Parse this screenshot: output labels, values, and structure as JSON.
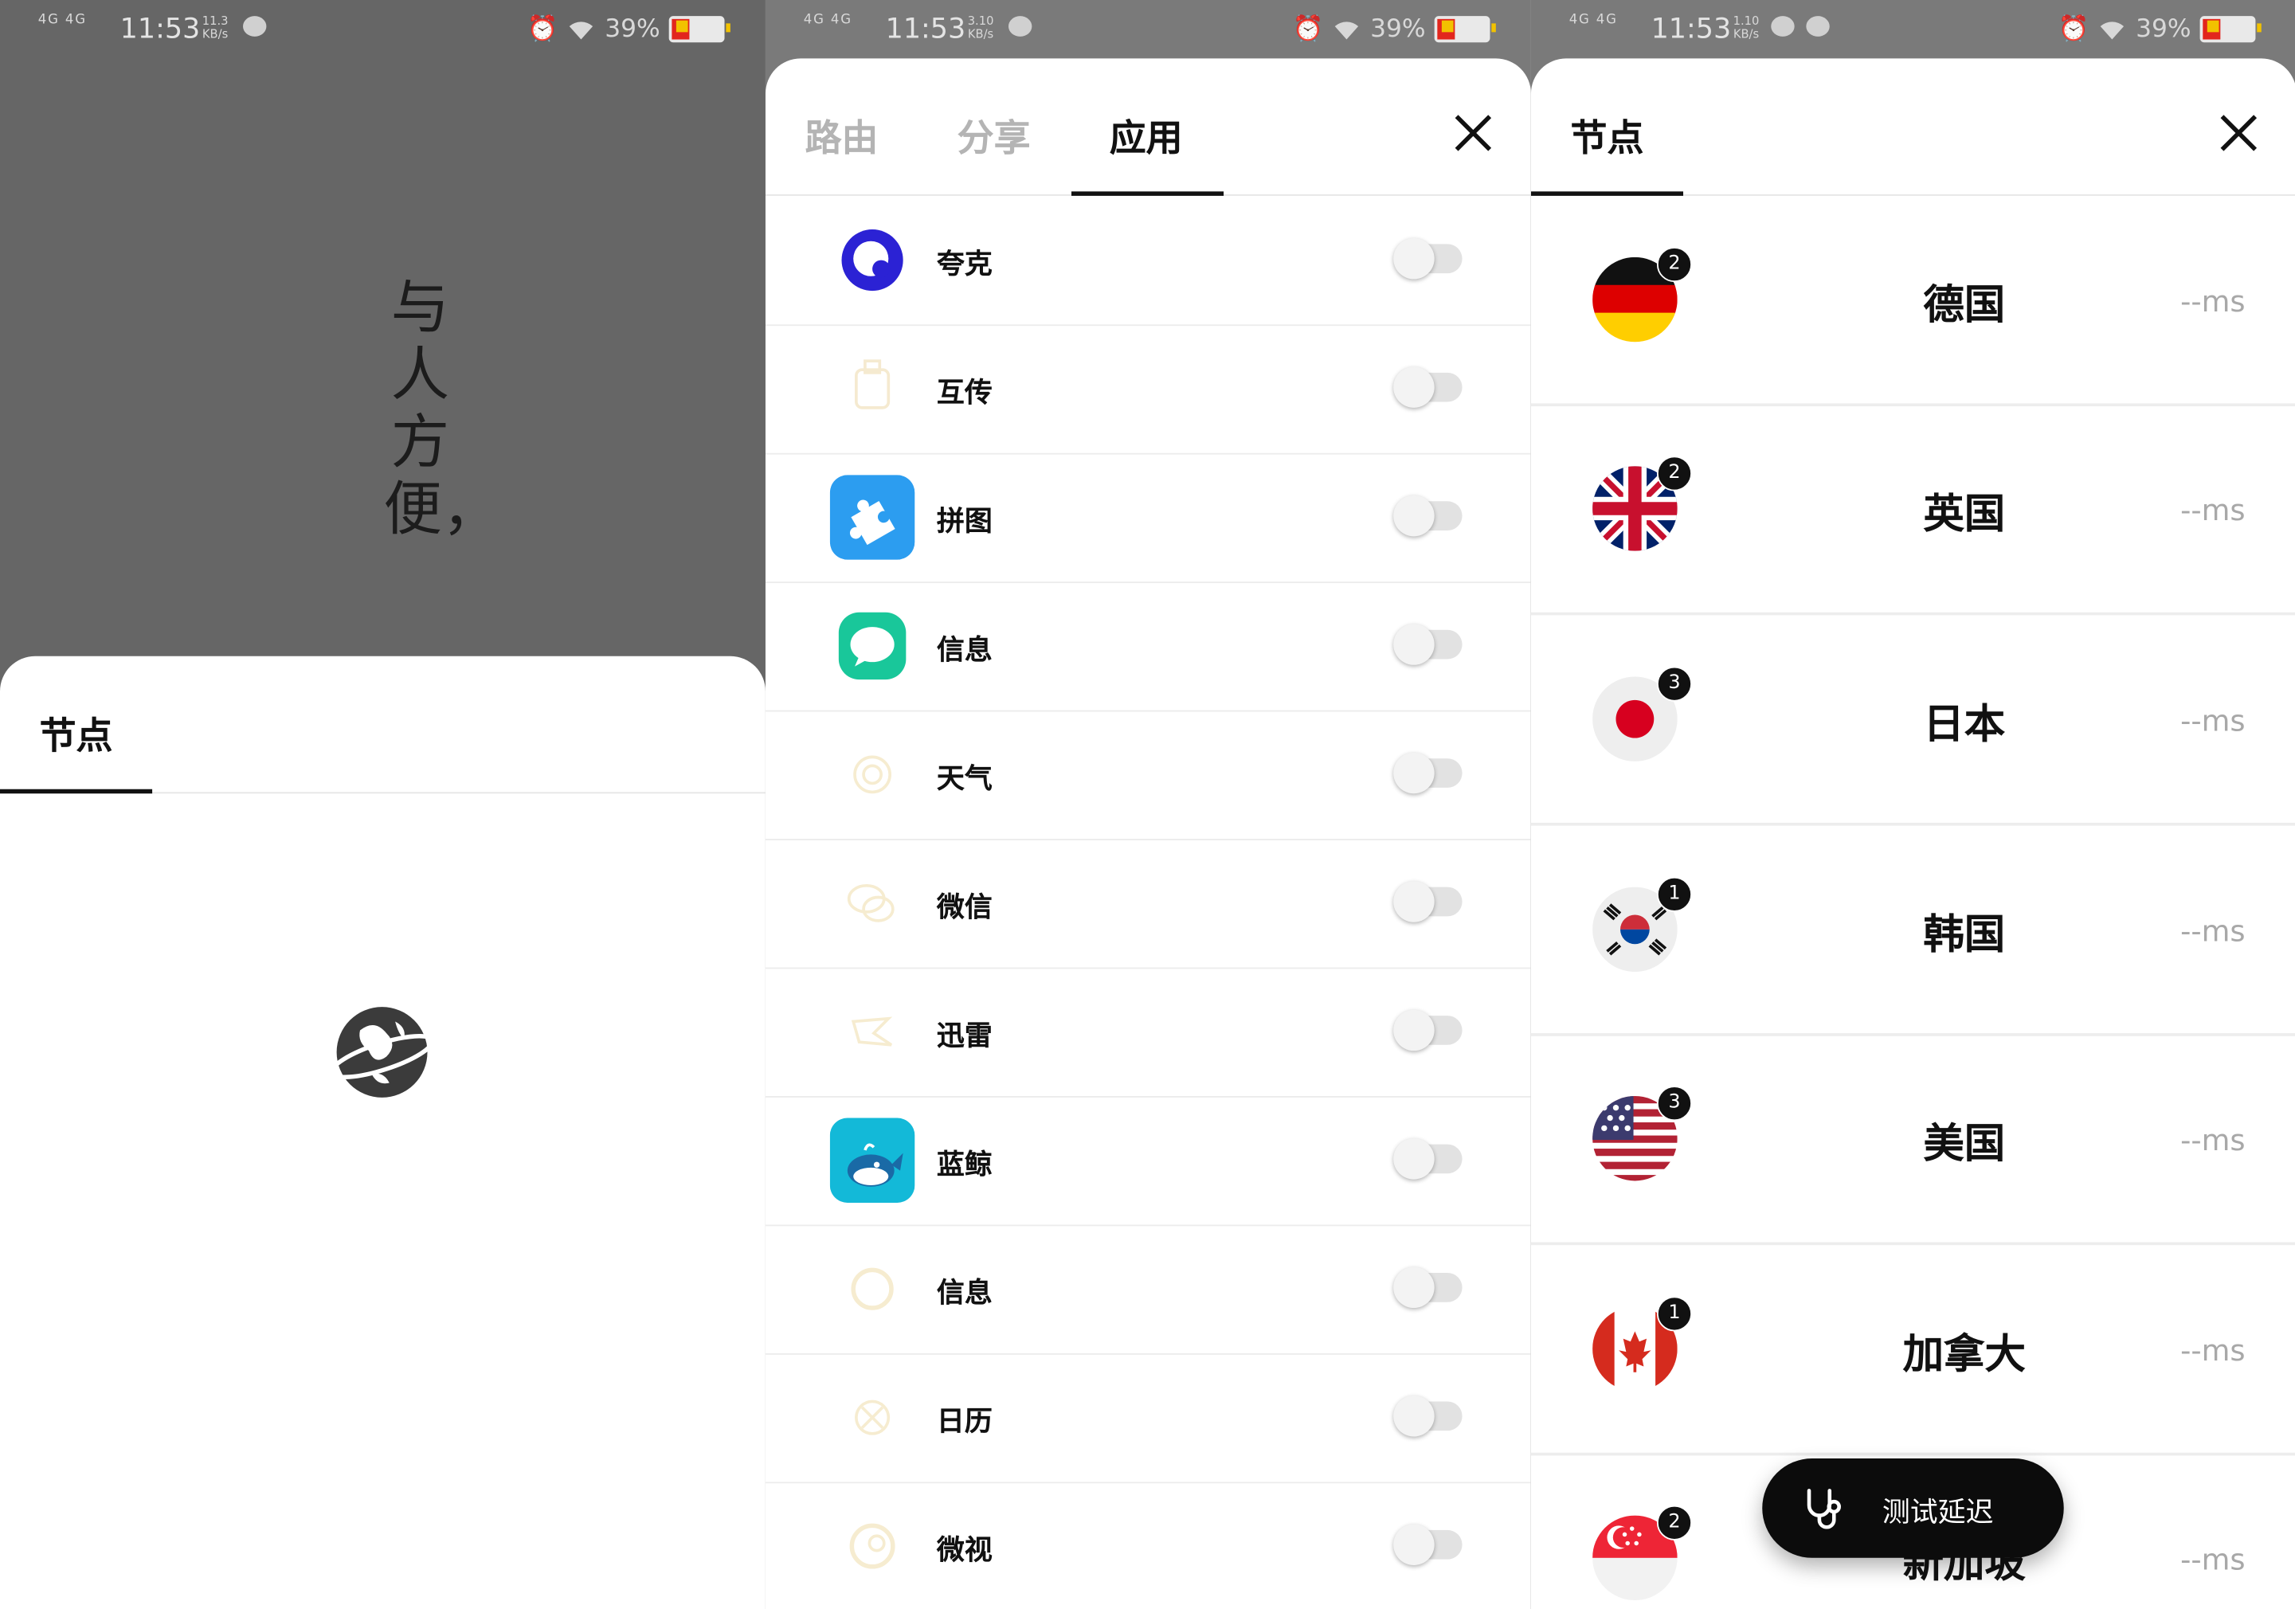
{
  "status_bars": [
    {
      "network": "4G 4G",
      "time": "11:53",
      "speed": "11.3 KB/s",
      "battery": "39%"
    },
    {
      "network": "4G 4G",
      "time": "11:53",
      "speed": "3.10 KB/s",
      "battery": "39%"
    },
    {
      "network": "4G 4G",
      "time": "11:53",
      "speed": "1.10 KB/s",
      "battery": "39%"
    }
  ],
  "panel1": {
    "calligraphy": "与人方便，",
    "tab": "节点",
    "loading_icon": "planet-logo-icon"
  },
  "panel2": {
    "tabs": [
      "路由",
      "分享",
      "应用"
    ],
    "active_tab": "应用",
    "apps": [
      {
        "name": "夸克",
        "icon": "quark-app-icon",
        "enabled": false
      },
      {
        "name": "互传",
        "icon": "transfer-app-icon",
        "enabled": false
      },
      {
        "name": "拼图",
        "icon": "puzzle-app-icon",
        "enabled": false
      },
      {
        "name": "信息",
        "icon": "messages-app-icon",
        "enabled": false
      },
      {
        "name": "天气",
        "icon": "weather-app-icon",
        "enabled": false
      },
      {
        "name": "微信",
        "icon": "wechat-app-icon",
        "enabled": false
      },
      {
        "name": "迅雷",
        "icon": "xunlei-app-icon",
        "enabled": false
      },
      {
        "name": "蓝鲸",
        "icon": "bluewhale-app-icon",
        "enabled": false
      },
      {
        "name": "信息",
        "icon": "messages-app-icon",
        "enabled": false
      },
      {
        "name": "日历",
        "icon": "calendar-app-icon",
        "enabled": false
      },
      {
        "name": "微视",
        "icon": "weishi-app-icon",
        "enabled": false
      }
    ]
  },
  "panel3": {
    "tab": "节点",
    "nodes": [
      {
        "name": "德国",
        "count": "2",
        "latency": "--ms",
        "flag": "germany-flag-icon"
      },
      {
        "name": "英国",
        "count": "2",
        "latency": "--ms",
        "flag": "uk-flag-icon"
      },
      {
        "name": "日本",
        "count": "3",
        "latency": "--ms",
        "flag": "japan-flag-icon"
      },
      {
        "name": "韩国",
        "count": "1",
        "latency": "--ms",
        "flag": "korea-flag-icon"
      },
      {
        "name": "美国",
        "count": "3",
        "latency": "--ms",
        "flag": "usa-flag-icon"
      },
      {
        "name": "加拿大",
        "count": "1",
        "latency": "--ms",
        "flag": "canada-flag-icon"
      },
      {
        "name": "新加坡",
        "count": "2",
        "latency": "--ms",
        "flag": "singapore-flag-icon"
      }
    ],
    "fab_label": "测试延迟",
    "fab_icon": "stethoscope-icon"
  }
}
